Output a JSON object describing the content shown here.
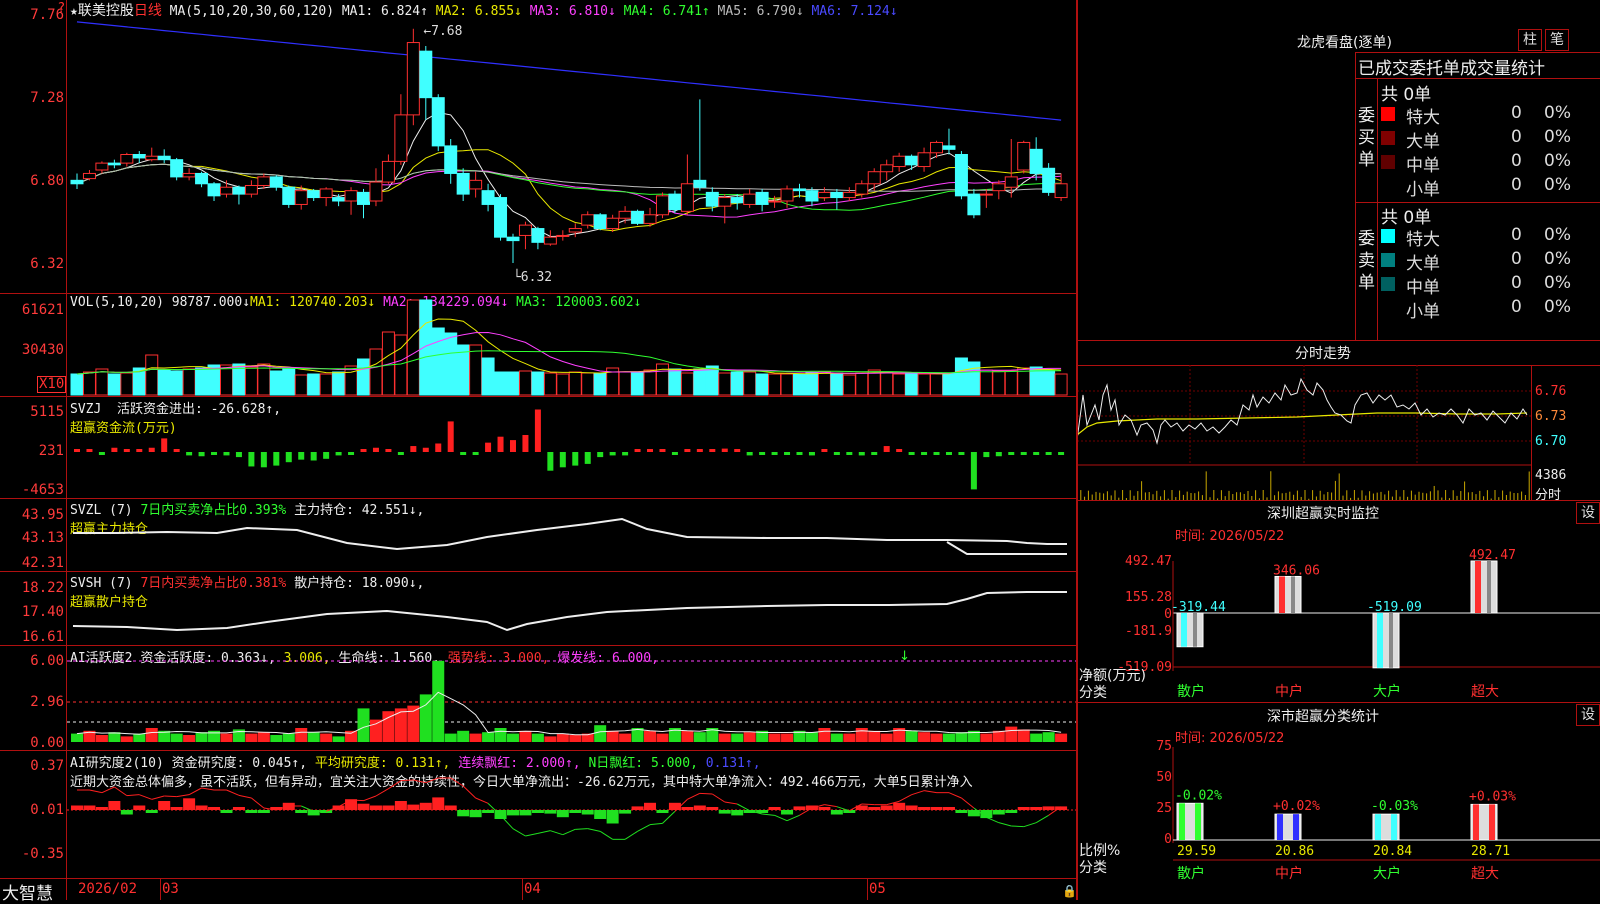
{
  "kline": {
    "star": "★",
    "stock_name": "联美控股",
    "period": "日线",
    "ma_label": "MA(5,10,20,30,60,120)",
    "ma": [
      {
        "label": "MA1: 6.824↑",
        "color": "#eeeeee"
      },
      {
        "label": "MA2: 6.855↓",
        "color": "#e8e800"
      },
      {
        "label": "MA3: 6.810↓",
        "color": "#ff40ff"
      },
      {
        "label": "MA4: 6.741↑",
        "color": "#30ff30"
      },
      {
        "label": "MA5: 6.790↓",
        "color": "#bbbbbb"
      },
      {
        "label": "MA6: 7.124↓",
        "color": "#4a4aff"
      }
    ],
    "y_labels": [
      "7.76",
      "7.28",
      "6.80",
      "6.32"
    ],
    "high_mark": "7.68",
    "low_mark": "6.32",
    "candles": [
      [
        6.8,
        6.78,
        6.84,
        6.75
      ],
      [
        6.81,
        6.84,
        6.86,
        6.8
      ],
      [
        6.86,
        6.9,
        6.91,
        6.84
      ],
      [
        6.9,
        6.89,
        6.92,
        6.87
      ],
      [
        6.9,
        6.95,
        6.96,
        6.88
      ],
      [
        6.95,
        6.93,
        6.97,
        6.9
      ],
      [
        6.92,
        6.94,
        6.99,
        6.91
      ],
      [
        6.94,
        6.92,
        6.98,
        6.9
      ],
      [
        6.92,
        6.82,
        6.93,
        6.8
      ],
      [
        6.82,
        6.84,
        6.87,
        6.8
      ],
      [
        6.84,
        6.78,
        6.85,
        6.76
      ],
      [
        6.78,
        6.71,
        6.79,
        6.68
      ],
      [
        6.72,
        6.76,
        6.8,
        6.7
      ],
      [
        6.76,
        6.72,
        6.77,
        6.66
      ],
      [
        6.72,
        6.77,
        6.8,
        6.7
      ],
      [
        6.77,
        6.82,
        6.84,
        6.75
      ],
      [
        6.82,
        6.76,
        6.83,
        6.74
      ],
      [
        6.76,
        6.66,
        6.77,
        6.64
      ],
      [
        6.66,
        6.74,
        6.77,
        6.63
      ],
      [
        6.74,
        6.7,
        6.75,
        6.68
      ],
      [
        6.7,
        6.75,
        6.76,
        6.65
      ],
      [
        6.7,
        6.68,
        6.72,
        6.65
      ],
      [
        6.68,
        6.74,
        6.76,
        6.6
      ],
      [
        6.73,
        6.66,
        6.75,
        6.58
      ],
      [
        6.68,
        6.79,
        6.87,
        6.65
      ],
      [
        6.79,
        6.91,
        6.95,
        6.78
      ],
      [
        6.91,
        7.18,
        7.3,
        6.89
      ],
      [
        7.18,
        7.6,
        7.68,
        7.12
      ],
      [
        7.55,
        7.28,
        7.58,
        7.15
      ],
      [
        7.28,
        7.0,
        7.3,
        6.97
      ],
      [
        7.0,
        6.84,
        7.04,
        6.78
      ],
      [
        6.84,
        6.72,
        6.87,
        6.68
      ],
      [
        6.75,
        6.8,
        6.85,
        6.7
      ],
      [
        6.74,
        6.66,
        6.78,
        6.62
      ],
      [
        6.7,
        6.47,
        6.72,
        6.45
      ],
      [
        6.47,
        6.45,
        6.49,
        6.32
      ],
      [
        6.48,
        6.54,
        6.56,
        6.4
      ],
      [
        6.52,
        6.44,
        6.53,
        6.4
      ],
      [
        6.43,
        6.47,
        6.51,
        6.42
      ],
      [
        6.48,
        6.48,
        6.51,
        6.45
      ],
      [
        6.5,
        6.52,
        6.55,
        6.47
      ],
      [
        6.54,
        6.6,
        6.62,
        6.52
      ],
      [
        6.6,
        6.52,
        6.61,
        6.51
      ],
      [
        6.52,
        6.58,
        6.6,
        6.5
      ],
      [
        6.58,
        6.62,
        6.65,
        6.55
      ],
      [
        6.62,
        6.55,
        6.63,
        6.54
      ],
      [
        6.55,
        6.6,
        6.64,
        6.53
      ],
      [
        6.6,
        6.71,
        6.73,
        6.58
      ],
      [
        6.72,
        6.63,
        6.74,
        6.61
      ],
      [
        6.62,
        6.78,
        6.95,
        6.6
      ],
      [
        6.8,
        6.76,
        7.27,
        6.74
      ],
      [
        6.73,
        6.65,
        6.76,
        6.62
      ],
      [
        6.65,
        6.7,
        6.72,
        6.55
      ],
      [
        6.7,
        6.67,
        6.72,
        6.63
      ],
      [
        6.66,
        6.72,
        6.75,
        6.64
      ],
      [
        6.73,
        6.66,
        6.75,
        6.62
      ],
      [
        6.68,
        6.68,
        6.71,
        6.64
      ],
      [
        6.68,
        6.75,
        6.77,
        6.64
      ],
      [
        6.75,
        6.74,
        6.78,
        6.7
      ],
      [
        6.74,
        6.68,
        6.76,
        6.65
      ],
      [
        6.7,
        6.73,
        6.76,
        6.68
      ],
      [
        6.73,
        6.7,
        6.75,
        6.63
      ],
      [
        6.7,
        6.73,
        6.76,
        6.68
      ],
      [
        6.72,
        6.78,
        6.8,
        6.7
      ],
      [
        6.78,
        6.85,
        6.87,
        6.74
      ],
      [
        6.85,
        6.89,
        6.92,
        6.8
      ],
      [
        6.88,
        6.94,
        6.96,
        6.85
      ],
      [
        6.94,
        6.89,
        6.95,
        6.86
      ],
      [
        6.88,
        6.96,
        6.99,
        6.85
      ],
      [
        6.96,
        7.02,
        7.03,
        6.93
      ],
      [
        7.0,
        6.98,
        7.1,
        6.95
      ],
      [
        6.95,
        6.71,
        6.97,
        6.69
      ],
      [
        6.72,
        6.6,
        6.75,
        6.58
      ],
      [
        6.72,
        6.72,
        6.75,
        6.64
      ],
      [
        6.74,
        6.78,
        6.8,
        6.69
      ],
      [
        6.76,
        6.82,
        7.04,
        6.7
      ],
      [
        6.86,
        7.02,
        7.03,
        6.84
      ],
      [
        6.98,
        6.84,
        7.05,
        6.8
      ],
      [
        6.87,
        6.73,
        6.9,
        6.71
      ],
      [
        6.7,
        6.78,
        6.84,
        6.68
      ]
    ],
    "date_labels": [
      "2026/02",
      "03",
      "04",
      "05"
    ]
  },
  "vol": {
    "label": "VOL(5,10,20)",
    "value": "98787.000↓",
    "mas": [
      {
        "label": "MA1: 120740.203↓",
        "color": "#e8e800"
      },
      {
        "label": "MA2: 134229.094↓",
        "color": "#ff40ff"
      },
      {
        "label": "MA3: 120003.602↓",
        "color": "#30ff30"
      }
    ],
    "y_labels": [
      "61621",
      "30430"
    ],
    "unit": "X10",
    "bars": [
      21,
      23,
      26,
      21,
      22,
      27,
      40,
      25,
      24,
      26,
      27,
      30,
      30,
      31,
      28,
      31,
      24,
      26,
      20,
      21,
      21,
      23,
      29,
      36,
      46,
      63,
      60,
      95,
      95,
      67,
      62,
      50,
      50,
      37,
      23,
      23,
      24,
      23,
      22,
      21,
      23,
      22,
      22,
      27,
      23,
      23,
      25,
      31,
      26,
      22,
      26,
      29,
      22,
      23,
      23,
      21,
      21,
      21,
      21,
      22,
      23,
      22,
      20,
      22,
      25,
      23,
      21,
      21,
      21,
      21,
      22,
      37,
      33,
      25,
      24,
      24,
      27,
      28,
      25,
      21
    ]
  },
  "svzj": {
    "label": "SVZJ",
    "metric": "活跃资金进出: -26.628↑,",
    "sub": "超赢资金流(万元)",
    "y_labels": [
      "5115",
      "231",
      "-4653"
    ],
    "bars": [
      0.1,
      0.1,
      -0.15,
      0.25,
      0.1,
      0.1,
      0.25,
      0.8,
      0.1,
      -0.2,
      -0.25,
      -0.1,
      -0.2,
      -0.3,
      -0.85,
      -0.9,
      -0.8,
      -0.6,
      -0.45,
      -0.5,
      -0.4,
      -0.2,
      -0.1,
      0.1,
      0.25,
      0.1,
      -0.1,
      0.35,
      0.25,
      0.5,
      1.8,
      -0.1,
      -0.1,
      0.55,
      0.9,
      0.7,
      1.0,
      2.5,
      -1.1,
      -0.9,
      -0.8,
      -0.7,
      -0.3,
      -0.2,
      -0.2,
      0.1,
      0.1,
      0.1,
      -0.1,
      0.1,
      0.15,
      0.1,
      0.2,
      0.1,
      -0.2,
      -0.15,
      -0.15,
      -0.1,
      -0.15,
      -0.2,
      0.15,
      -0.1,
      -0.1,
      -0.2,
      -0.15,
      0.35,
      0.1,
      -0.1,
      -0.1,
      -0.1,
      -0.15,
      -0.1,
      -2.2,
      -0.3,
      -0.25,
      -0.15,
      -0.1,
      -0.1,
      -0.1,
      -0.1
    ]
  },
  "svzl": {
    "label": "SVZL (7)",
    "ratio": "7日内买卖净占比0.393%",
    "metric": "主力持仓: 42.551↓,",
    "sub": "超赢主力持仓",
    "y_labels": [
      "43.95",
      "43.13",
      "42.31"
    ]
  },
  "svsh": {
    "label": "SVSH (7)",
    "ratio": "7日内买卖净占比0.381%",
    "metric": "散户持仓: 18.090↓,",
    "sub": "超赢散户持仓",
    "y_labels": [
      "18.22",
      "17.40",
      "16.61"
    ]
  },
  "ai_active": {
    "label": "AI活跃度2",
    "items": [
      {
        "text": "资金活跃度: 0.363↓,",
        "color": "#eeeeee"
      },
      {
        "text": "3.006,",
        "color": "#e8e800"
      },
      {
        "text": "生命线: 1.560,",
        "color": "#eeeeee"
      },
      {
        "text": "强势线: 3.000,",
        "color": "#ff3030"
      },
      {
        "text": "爆发线: 6.000,",
        "color": "#ff40ff"
      }
    ],
    "y_labels": [
      "6.00",
      "2.96",
      "0.00"
    ],
    "bars": [
      0.3,
      0.4,
      0.25,
      0.35,
      0.2,
      0.3,
      0.5,
      0.4,
      0.3,
      0.25,
      0.35,
      0.4,
      0.3,
      0.45,
      0.3,
      0.35,
      0.25,
      0.3,
      0.5,
      0.35,
      0.3,
      0.2,
      0.4,
      1.2,
      0.8,
      1.1,
      1.2,
      1.3,
      1.7,
      2.9,
      0.3,
      0.4,
      0.3,
      0.35,
      0.5,
      0.3,
      0.4,
      0.3,
      0.2,
      0.3,
      0.25,
      0.3,
      0.6,
      0.4,
      0.3,
      0.5,
      0.4,
      0.3,
      0.5,
      0.4,
      0.35,
      0.5,
      0.3,
      0.3,
      0.35,
      0.4,
      0.3,
      0.3,
      0.4,
      0.35,
      0.5,
      0.3,
      0.3,
      0.5,
      0.4,
      0.3,
      0.5,
      0.4,
      0.35,
      0.3,
      0.3,
      0.35,
      0.4,
      0.3,
      0.4,
      0.55,
      0.45,
      0.3,
      0.35,
      0.3
    ]
  },
  "ai_research": {
    "label": "AI研究度2(10)",
    "items": [
      {
        "text": "资金研究度: 0.045↑,",
        "color": "#eeeeee"
      },
      {
        "text": "平均研究度: 0.131↑,",
        "color": "#e8e800"
      },
      {
        "text": "连续飘红: 2.000↑,",
        "color": "#ff40ff"
      },
      {
        "text": "N日飘红: 5.000,",
        "color": "#30ff30"
      },
      {
        "text": "0.131↑,",
        "color": "#4a4aff"
      }
    ],
    "summary": "近期大资金总体偏多，虽不活跃，但有异动，宜关注大资金的持续性，今日大单净流出：-26.62万元，其中特大单净流入：492.466万元，大单5日累计净入",
    "y_labels": [
      "0.37",
      "0.01",
      "-0.35"
    ],
    "bars": [
      0.05,
      0.05,
      0.03,
      0.1,
      -0.05,
      0.05,
      -0.02,
      0.1,
      0.02,
      0.13,
      0.05,
      0.02,
      -0.02,
      0.02,
      -0.02,
      -0.02,
      0.02,
      0.08,
      -0.02,
      -0.06,
      -0.02,
      0.05,
      0.12,
      0.07,
      0.05,
      0.05,
      0.1,
      0.06,
      0.08,
      0.14,
      0.05,
      -0.07,
      -0.08,
      -0.02,
      -0.1,
      -0.06,
      -0.06,
      -0.03,
      -0.04,
      -0.08,
      -0.02,
      -0.05,
      -0.1,
      -0.15,
      -0.04,
      0.04,
      0.08,
      -0.03,
      0.08,
      0.03,
      0.05,
      0.03,
      -0.04,
      -0.06,
      -0.02,
      -0.02,
      0.03,
      -0.05,
      0.04,
      0.05,
      0.03,
      -0.05,
      -0.03,
      0.05,
      0.03,
      0.05,
      0.08,
      0.05,
      0.03,
      0.02,
      0.03,
      -0.03,
      -0.07,
      -0.09,
      -0.05,
      -0.03,
      0.02,
      0.03,
      0.04,
      0.04
    ]
  },
  "brand": "大智慧",
  "dragon": {
    "title": "龙虎看盘(逐单)",
    "btn_bar": "柱",
    "btn_brush": "笔",
    "header": "已成交委托单成交量统计",
    "buy_label": "委买单",
    "sell_label": "委卖单",
    "buy_total": "共 0单",
    "sell_total": "共 0单",
    "buy_rows": [
      {
        "name": "特大",
        "count": "0",
        "pct": "0%",
        "color": "#ff0000"
      },
      {
        "name": "大单",
        "count": "0",
        "pct": "0%",
        "color": "#800000"
      },
      {
        "name": "中单",
        "count": "0",
        "pct": "0%",
        "color": "#600000"
      },
      {
        "name": "小单",
        "count": "0",
        "pct": "0%",
        "color": "#000000"
      }
    ],
    "sell_rows": [
      {
        "name": "特大",
        "count": "0",
        "pct": "0%",
        "color": "#00ffff"
      },
      {
        "name": "大单",
        "count": "0",
        "pct": "0%",
        "color": "#008080"
      },
      {
        "name": "中单",
        "count": "0",
        "pct": "0%",
        "color": "#006060"
      },
      {
        "name": "小单",
        "count": "0",
        "pct": "0%",
        "color": "#000000"
      }
    ]
  },
  "intraday": {
    "title": "分时走势",
    "y_labels": [
      "6.76",
      "6.73",
      "6.70"
    ],
    "vol_label": "4386",
    "vol_label2": "分时"
  },
  "monitor": {
    "title": "深圳超赢实时监控",
    "btn": "设",
    "time": "时间: 2026/05/22",
    "y_labels": [
      "492.47",
      "155.28",
      "0",
      "-181.9",
      "-519.09"
    ],
    "axis_label1": "净额(万元)",
    "axis_label2": "分类",
    "categories": [
      "散户",
      "中户",
      "大户",
      "超大"
    ],
    "values": [
      -319.44,
      346.06,
      -519.09,
      492.47
    ],
    "value_labels": [
      "-319.44",
      "346.06",
      "-519.09",
      "492.47"
    ]
  },
  "classify": {
    "title": "深市超赢分类统计",
    "btn": "设",
    "time": "时间: 2026/05/22",
    "y_labels": [
      "75",
      "50",
      "25",
      "0"
    ],
    "axis_label1": "比例%",
    "axis_label2": "分类",
    "categories": [
      "散户",
      "中户",
      "大户",
      "超大"
    ],
    "values": [
      29.59,
      20.86,
      20.84,
      28.71
    ],
    "changes": [
      "-0.02%",
      "+0.02%",
      "-0.03%",
      "+0.03%"
    ],
    "change_colors": [
      "#30ff30",
      "#ff3030",
      "#30ff30",
      "#ff3030"
    ],
    "colors": [
      "#30ff30",
      "#3030ff",
      "#40ffff",
      "#ff3030"
    ]
  }
}
